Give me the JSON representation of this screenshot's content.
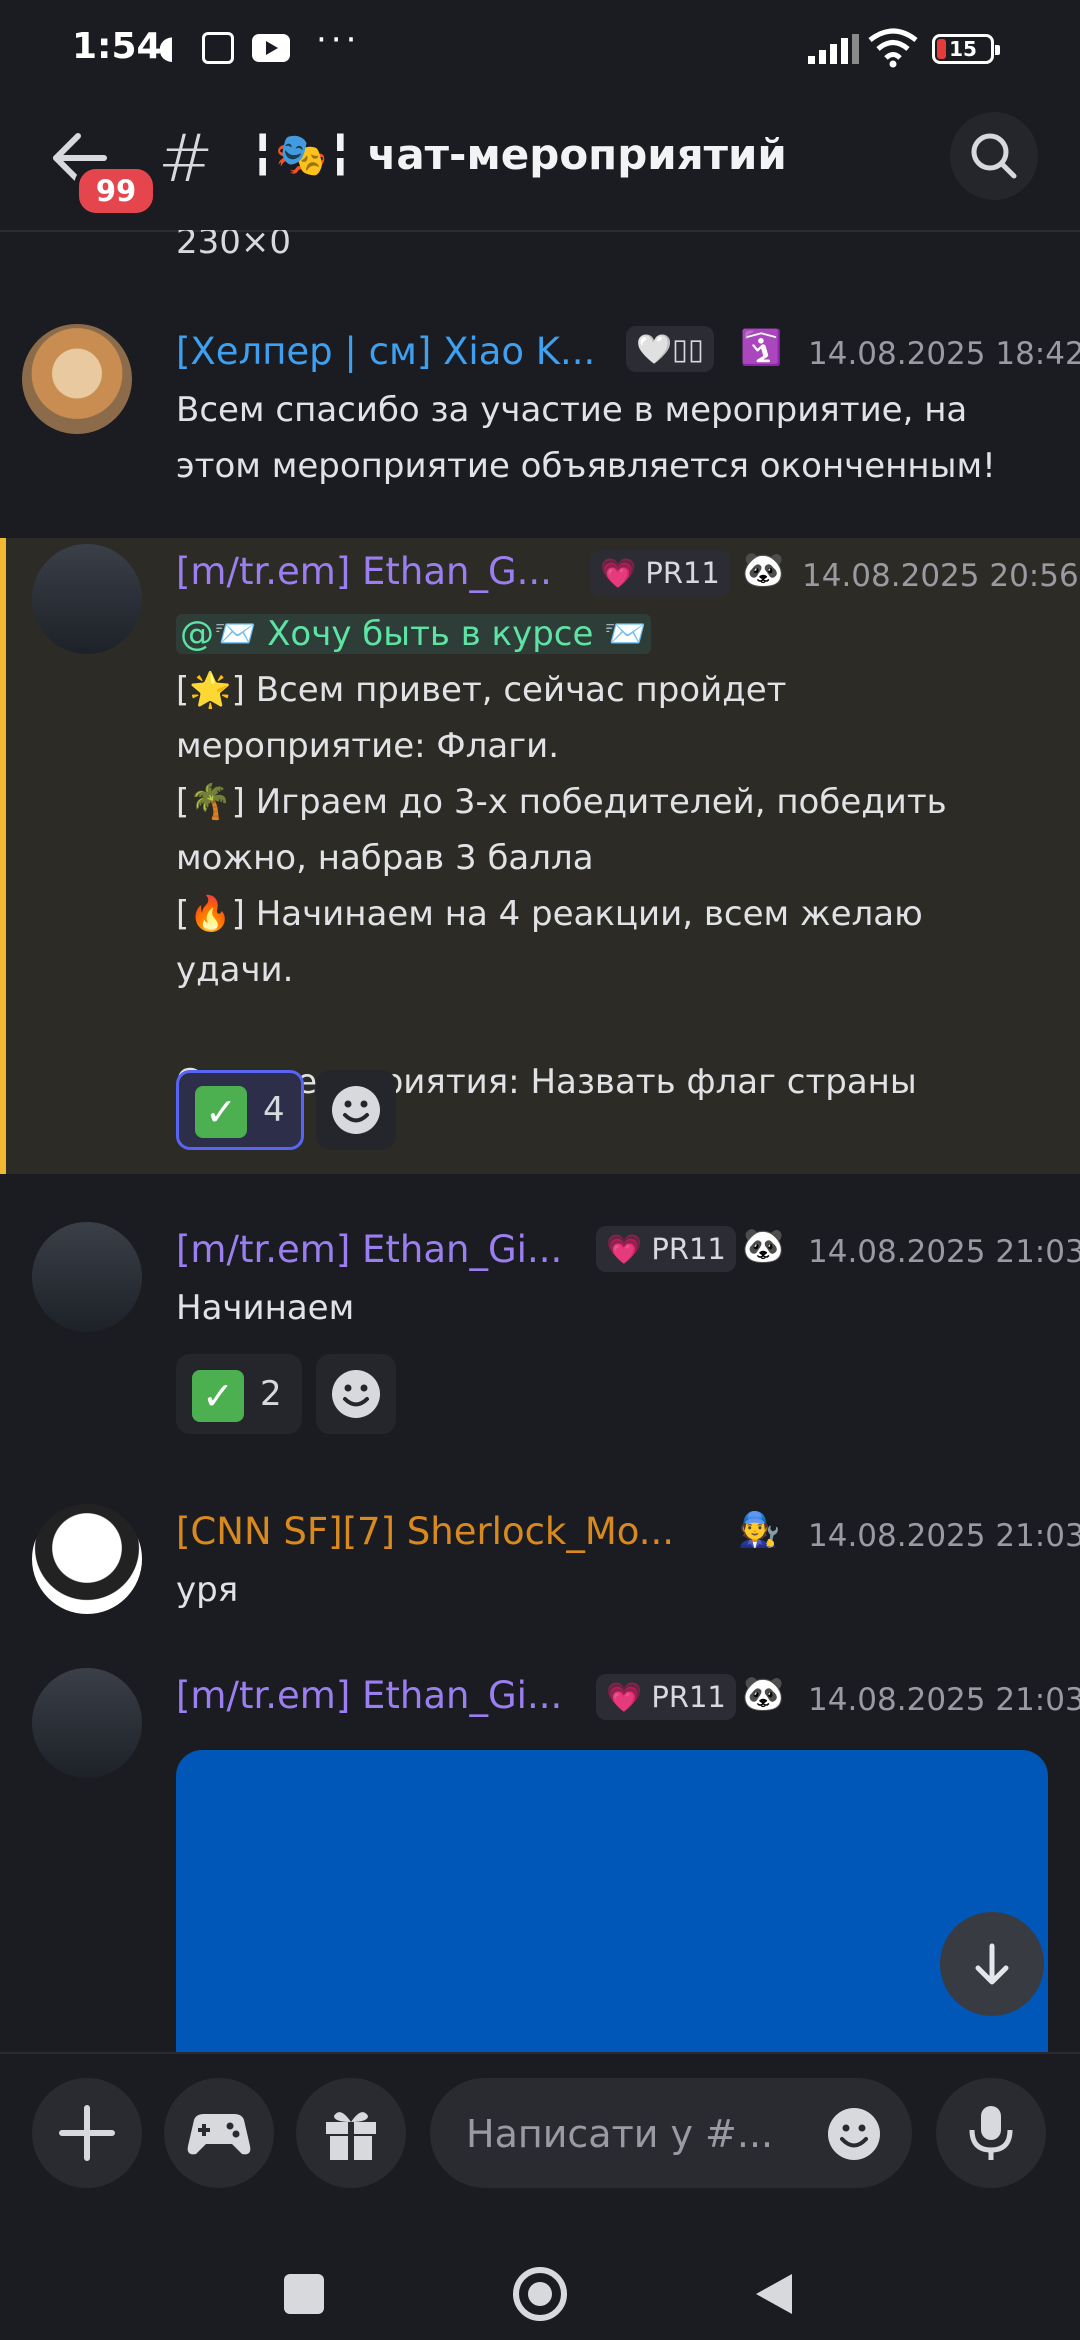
{
  "status_bar": {
    "time": "1:54",
    "battery": "15",
    "more": "···"
  },
  "header": {
    "notification_count": "99",
    "channel_prefix": "╏🎭╏",
    "channel_name": "чат-мероприятий",
    "chevron": "›"
  },
  "prev_message_tail": "230×0",
  "messages": [
    {
      "author": "[Хелпер | см] Xiao K...",
      "tag": "🤍▯▯",
      "badge_emoji": "🛐",
      "timestamp": "14.08.2025 18:42",
      "text": "Всем спасибо за участие в мероприятие, на этом мероприятие объявляется оконченным!",
      "name_color": "#3ea0f0"
    },
    {
      "author": "[m/tr.em] Ethan_G...",
      "tag_icon": "💗",
      "tag": "PR11",
      "badge_emoji": "🐼",
      "timestamp": "14.08.2025 20:56",
      "mention": "@📨 Хочу быть в курсе 📨",
      "lines": [
        {
          "emoji": "🌟",
          "text": "Всем привет, сейчас пройдет мероприятие: Флаги."
        },
        {
          "emoji": "🌴",
          "text": "Играем до 3-х победителей, победить можно, набрав 3 балла"
        },
        {
          "emoji": "🔥",
          "text": "Начинаем на 4 реакции, всем желаю удачи."
        }
      ],
      "summary": "Суть мероприятия: Назвать флаг страны",
      "reaction_count": "4",
      "name_color": "#9b7ff0"
    },
    {
      "author": "[m/tr.em] Ethan_Gi...",
      "tag_icon": "💗",
      "tag": "PR11",
      "badge_emoji": "🐼",
      "timestamp": "14.08.2025 21:03",
      "text": "Начинаем",
      "reaction_count": "2",
      "name_color": "#9b7ff0"
    },
    {
      "author": "[CNN SF][7] Sherlock_Mo...",
      "badge_emoji": "🧑‍🔧",
      "timestamp": "14.08.2025 21:03",
      "text": "уря",
      "name_color": "#d98a1f"
    },
    {
      "author": "[m/tr.em] Ethan_Gi...",
      "tag_icon": "💗",
      "tag": "PR11",
      "badge_emoji": "🐼",
      "timestamp": "14.08.2025 21:03",
      "name_color": "#9b7ff0"
    }
  ],
  "composer": {
    "placeholder": "Написати у #..."
  },
  "icons": [
    "back-arrow-icon",
    "hash-icon",
    "search-icon",
    "smiley-icon",
    "arrow-down-icon",
    "plus-icon",
    "gamepad-icon",
    "gift-icon",
    "mic-icon",
    "square-icon",
    "circle-icon",
    "triangle-icon"
  ]
}
